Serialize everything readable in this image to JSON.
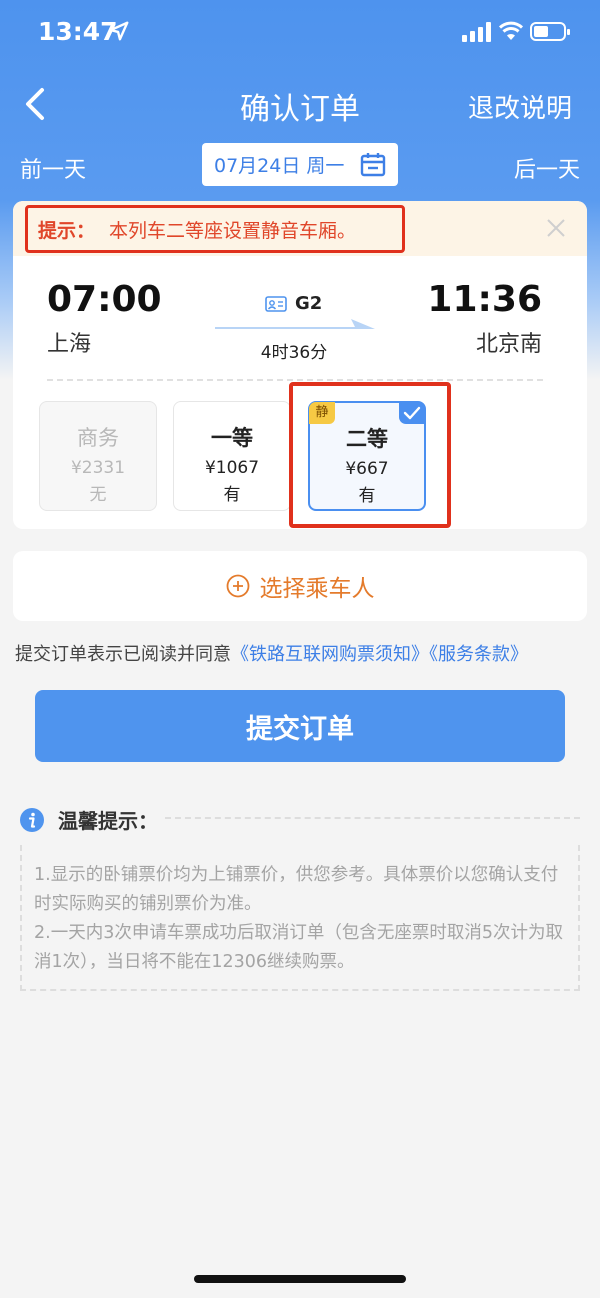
{
  "status_bar": {
    "time": "13:47"
  },
  "nav": {
    "title": "确认订单",
    "right_label": "退改说明"
  },
  "date_bar": {
    "prev_label": "前一天",
    "next_label": "后一天",
    "date": "07月24日 周一"
  },
  "notice": {
    "label": "提示：",
    "text": "本列车二等座设置静音车厢。"
  },
  "train": {
    "departure_time": "07:00",
    "departure_station": "上海",
    "arrival_time": "11:36",
    "arrival_station": "北京南",
    "number": "G2",
    "duration": "4时36分"
  },
  "seats": [
    {
      "name": "商务",
      "price": "¥2331",
      "availability": "无",
      "state": "unavailable"
    },
    {
      "name": "一等",
      "price": "¥1067",
      "availability": "有",
      "state": "available"
    },
    {
      "name": "二等",
      "price": "¥667",
      "availability": "有",
      "state": "selected",
      "tag": "静"
    }
  ],
  "passenger": {
    "label": "选择乘车人"
  },
  "agreement": {
    "prefix": "提交订单表示已阅读并同意",
    "link1": "《铁路互联网购票须知》",
    "link2": "《服务条款》"
  },
  "submit": {
    "label": "提交订单"
  },
  "tips": {
    "title": "温馨提示：",
    "line1": "1.显示的卧铺票价均为上铺票价，供您参考。具体票价以您确认支付时实际购买的铺别票价为准。",
    "line2": "2.一天内3次申请车票成功后取消订单（包含无座票时取消5次计为取消1次），当日将不能在12306继续购票。"
  },
  "colors": {
    "primary": "#4f94ee",
    "warning": "#e0311c",
    "accent_orange": "#e47b2c"
  }
}
